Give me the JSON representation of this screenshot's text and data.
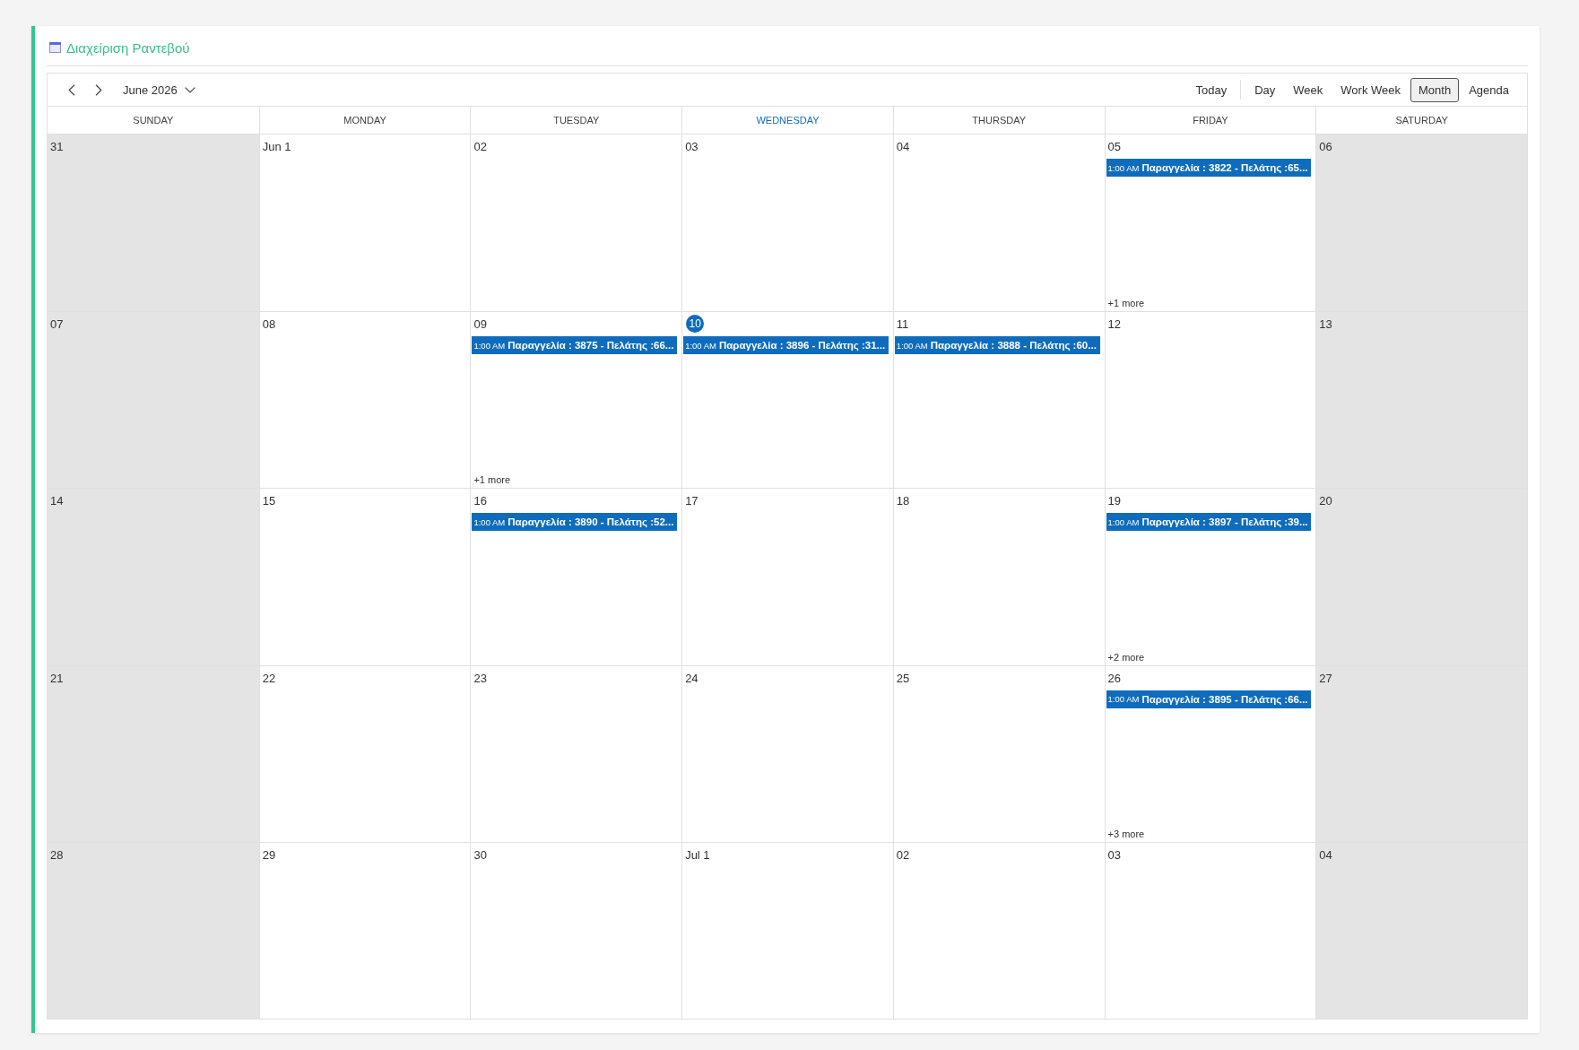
{
  "title": "Διαχείριση Ραντεβού",
  "toolbar": {
    "period": "June 2026",
    "today_button": "Today",
    "views": [
      {
        "label": "Day",
        "selected": false
      },
      {
        "label": "Week",
        "selected": false
      },
      {
        "label": "Work Week",
        "selected": false
      },
      {
        "label": "Month",
        "selected": true
      },
      {
        "label": "Agenda",
        "selected": false
      }
    ]
  },
  "weekdays": [
    {
      "label": "SUNDAY",
      "today": false,
      "weekend": true
    },
    {
      "label": "MONDAY",
      "today": false,
      "weekend": false
    },
    {
      "label": "TUESDAY",
      "today": false,
      "weekend": false
    },
    {
      "label": "WEDNESDAY",
      "today": true,
      "weekend": false
    },
    {
      "label": "THURSDAY",
      "today": false,
      "weekend": false
    },
    {
      "label": "FRIDAY",
      "today": false,
      "weekend": false
    },
    {
      "label": "SATURDAY",
      "today": false,
      "weekend": true
    }
  ],
  "weeks": [
    {
      "days": [
        {
          "date": "31",
          "today": false
        },
        {
          "date": "Jun 1",
          "today": false
        },
        {
          "date": "02",
          "today": false
        },
        {
          "date": "03",
          "today": false
        },
        {
          "date": "04",
          "today": false
        },
        {
          "date": "05",
          "today": false,
          "events": [
            {
              "time": "1:00 AM",
              "title": "Παραγγελία : 3822 - Πελάτης :65..."
            }
          ],
          "more": "+1 more"
        },
        {
          "date": "06",
          "today": false
        }
      ]
    },
    {
      "days": [
        {
          "date": "07",
          "today": false
        },
        {
          "date": "08",
          "today": false
        },
        {
          "date": "09",
          "today": false,
          "events": [
            {
              "time": "1:00 AM",
              "title": "Παραγγελία : 3875 - Πελάτης :66..."
            }
          ],
          "more": "+1 more"
        },
        {
          "date": "10",
          "today": true,
          "events": [
            {
              "time": "1:00 AM",
              "title": "Παραγγελία : 3896 - Πελάτης :31..."
            }
          ]
        },
        {
          "date": "11",
          "today": false,
          "events": [
            {
              "time": "1:00 AM",
              "title": "Παραγγελία : 3888 - Πελάτης :60..."
            }
          ]
        },
        {
          "date": "12",
          "today": false
        },
        {
          "date": "13",
          "today": false
        }
      ]
    },
    {
      "days": [
        {
          "date": "14",
          "today": false
        },
        {
          "date": "15",
          "today": false
        },
        {
          "date": "16",
          "today": false,
          "events": [
            {
              "time": "1:00 AM",
              "title": "Παραγγελία : 3890 - Πελάτης :52..."
            }
          ]
        },
        {
          "date": "17",
          "today": false
        },
        {
          "date": "18",
          "today": false
        },
        {
          "date": "19",
          "today": false,
          "events": [
            {
              "time": "1:00 AM",
              "title": "Παραγγελία : 3897 - Πελάτης :39..."
            }
          ],
          "more": "+2 more"
        },
        {
          "date": "20",
          "today": false
        }
      ]
    },
    {
      "days": [
        {
          "date": "21",
          "today": false
        },
        {
          "date": "22",
          "today": false
        },
        {
          "date": "23",
          "today": false
        },
        {
          "date": "24",
          "today": false
        },
        {
          "date": "25",
          "today": false
        },
        {
          "date": "26",
          "today": false,
          "events": [
            {
              "time": "1:00 AM",
              "title": "Παραγγελία : 3895 - Πελάτης :66..."
            }
          ],
          "more": "+3 more"
        },
        {
          "date": "27",
          "today": false
        }
      ]
    },
    {
      "days": [
        {
          "date": "28",
          "today": false
        },
        {
          "date": "29",
          "today": false
        },
        {
          "date": "30",
          "today": false
        },
        {
          "date": "Jul 1",
          "today": false
        },
        {
          "date": "02",
          "today": false
        },
        {
          "date": "03",
          "today": false
        },
        {
          "date": "04",
          "today": false
        }
      ]
    }
  ]
}
